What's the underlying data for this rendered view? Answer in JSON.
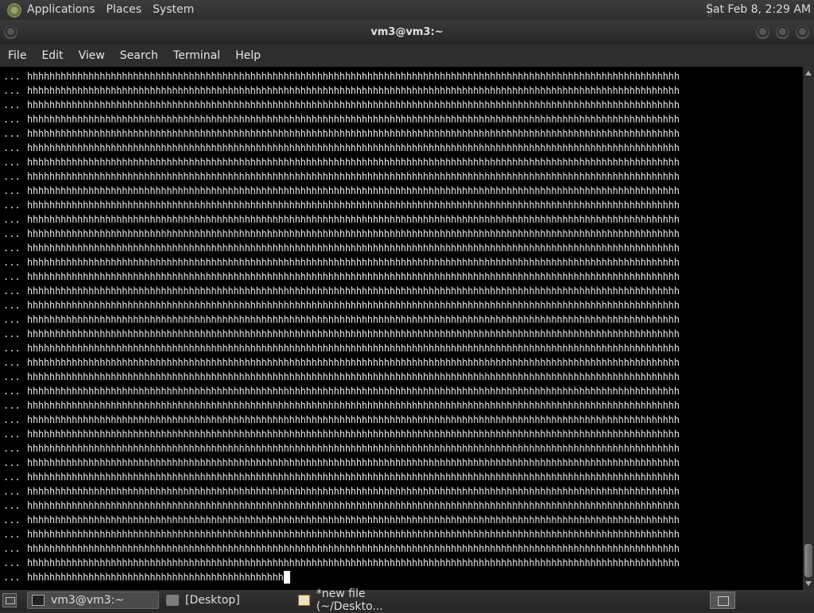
{
  "top_panel": {
    "menus": [
      "Applications",
      "Places",
      "System"
    ],
    "clock": "Sat Feb  8,  2:29 AM"
  },
  "window": {
    "title": "vm3@vm3:~"
  },
  "menubar": {
    "items": [
      "File",
      "Edit",
      "View",
      "Search",
      "Terminal",
      "Help"
    ]
  },
  "terminal": {
    "prompt": "...",
    "full_line_count": 35,
    "full_line": "hhhhhhhhhhhhhhhhhhhhhhhhhhhhhhhhhhhhhhhhhhhhhhhhhhhhhhhhhhhhhhhhhhhhhhhhhhhhhhhhhhhhhhhhhhhhhhhhhhhhhhhhhhhhhhhhhhhhh",
    "last_line": "hhhhhhhhhhhhhhhhhhhhhhhhhhhhhhhhhhhhhhhhhhhhhh"
  },
  "taskbar": {
    "tasks": [
      {
        "label": "vm3@vm3:~",
        "icon": "terminal-icon"
      },
      {
        "label": "[Desktop]",
        "icon": "folder-icon"
      },
      {
        "label": "*new file (~/Deskto...",
        "icon": "text-editor-icon"
      }
    ]
  }
}
